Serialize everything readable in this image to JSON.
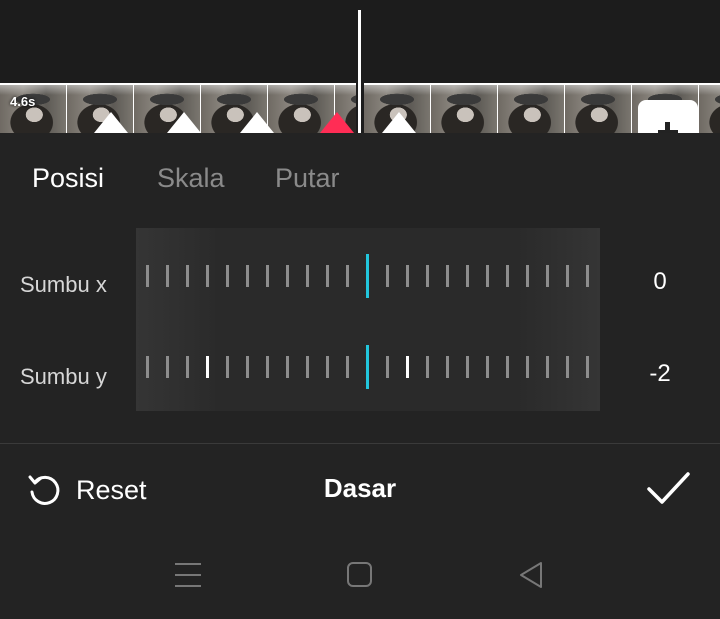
{
  "timeline": {
    "clip_duration": "4.6s",
    "icons": {
      "keyframe": "keyframe-diamond-icon",
      "add": "plus-icon"
    },
    "colors": {
      "keyframe": "#ffffff",
      "keyframe_selected": "#ff2d55"
    }
  },
  "tabs": [
    {
      "label": "Posisi",
      "active": true
    },
    {
      "label": "Skala",
      "active": false
    },
    {
      "label": "Putar",
      "active": false
    }
  ],
  "sliders": [
    {
      "label": "Sumbu x",
      "value": "0"
    },
    {
      "label": "Sumbu y",
      "value": "-2"
    }
  ],
  "bottom_bar": {
    "reset_label": "Reset",
    "title": "Dasar",
    "icons": {
      "reset": "reset-icon",
      "confirm": "checkmark-icon"
    }
  },
  "system_nav": {
    "icons": [
      "menu-icon",
      "home-icon",
      "back-icon"
    ]
  },
  "colors": {
    "accent": "#22c6dc",
    "background": "#232323"
  }
}
